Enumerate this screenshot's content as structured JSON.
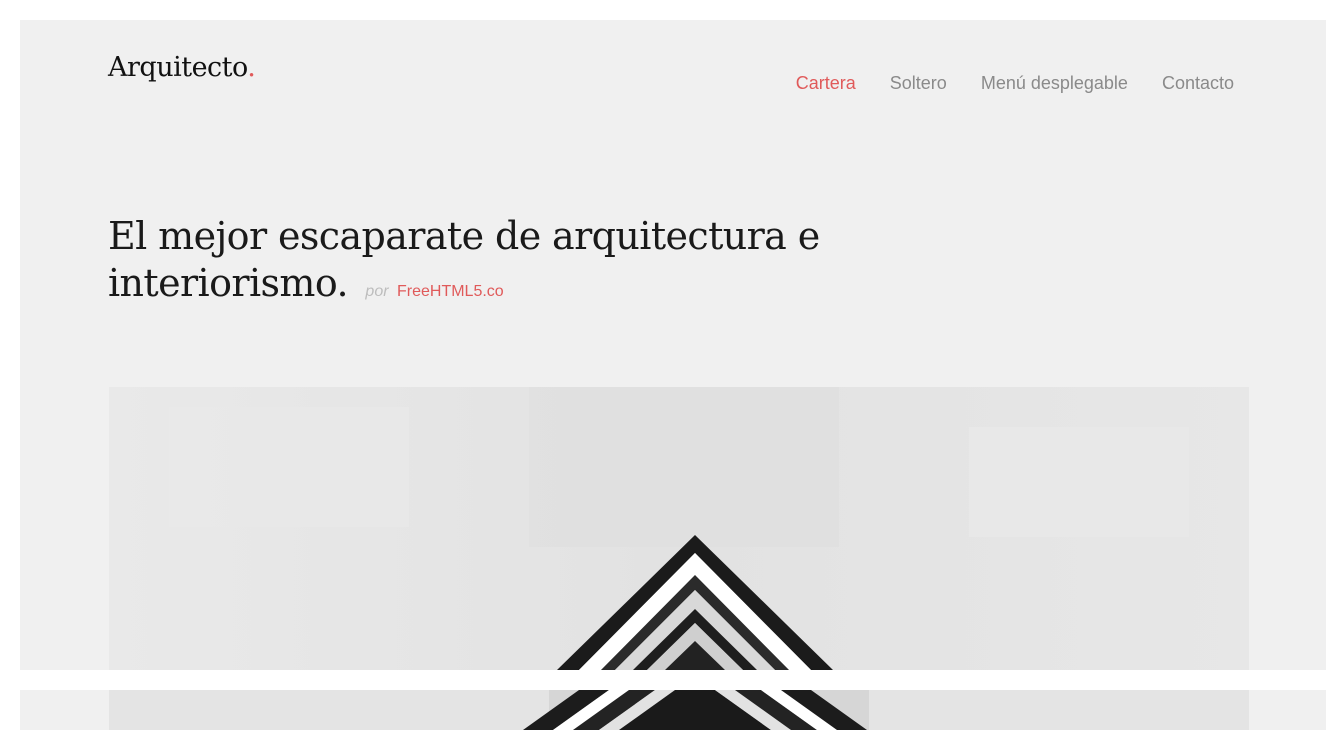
{
  "header": {
    "logo_text": "Arquitecto",
    "logo_dot": "."
  },
  "nav": {
    "items": [
      {
        "label": "Cartera",
        "active": true
      },
      {
        "label": "Soltero",
        "active": false
      },
      {
        "label": "Menú desplegable",
        "active": false
      },
      {
        "label": "Contacto",
        "active": false
      }
    ]
  },
  "hero": {
    "title": "El mejor escaparate de arquitectura e interiorismo.",
    "by_label": "por",
    "credit_label": "FreeHTML5.co"
  },
  "image": {
    "subject": "black-and-white building corner"
  },
  "colors": {
    "accent": "#e05a5a",
    "panel_bg": "#f0f0f0",
    "nav_text": "#8a8a8a"
  }
}
